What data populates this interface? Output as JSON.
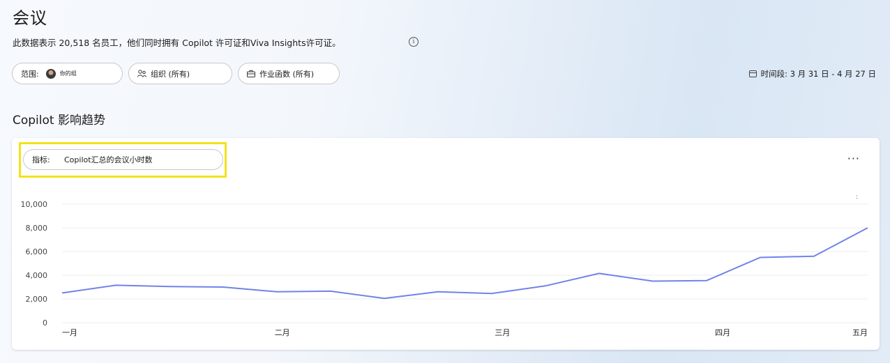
{
  "page": {
    "title": "会议",
    "subtitle": "此数据表示 20,518 名员工，他们同时拥有 Copilot 许可证和Viva Insights许可证。",
    "info_icon": "info-icon"
  },
  "filters": {
    "scope_label": "范围:",
    "scope_value": "你的组",
    "org_label": "组织 (所有)",
    "job_label": "作业函数 (所有)",
    "period_label": "时间段: 3 月 31 日 - 4 月 27 日"
  },
  "section": {
    "title": "Copilot 影响趋势"
  },
  "card": {
    "metric_label": "指标:",
    "metric_value": "Copilot汇总的会议小时数",
    "more_label": "···",
    "tiny_mark": ":"
  },
  "colors": {
    "line": "#7083e8",
    "highlight": "#f3e21a"
  },
  "chart_data": {
    "type": "line",
    "y_ticks": [
      "10,000",
      "8,000",
      "6,000",
      "4,000",
      "2,000",
      "0"
    ],
    "x_tick_labels": [
      "一月",
      "二月",
      "三月",
      "四月",
      "五月"
    ],
    "ylim": [
      0,
      10000
    ],
    "series": [
      {
        "values": [
          2500,
          3150,
          3050,
          3000,
          2600,
          2650,
          2050,
          2600,
          2450,
          3100,
          4150,
          3500,
          3550,
          5500,
          5600,
          8000
        ]
      }
    ]
  }
}
